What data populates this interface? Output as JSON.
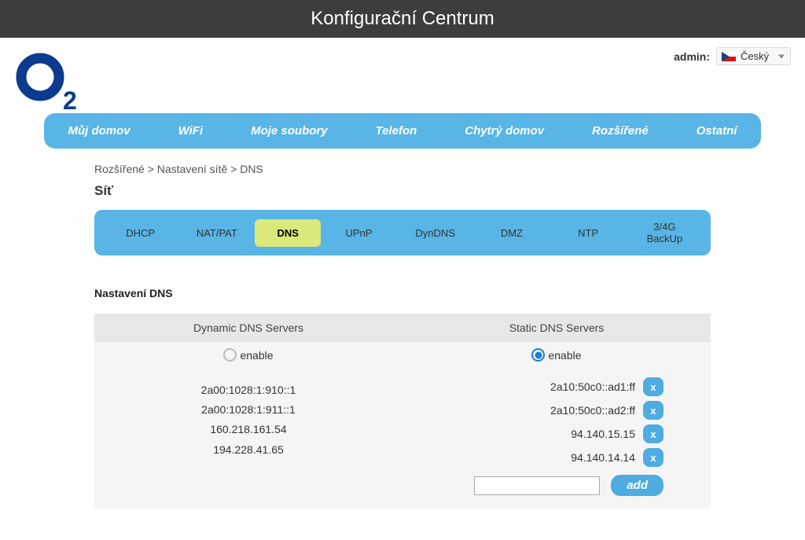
{
  "topbar": {
    "title": "Konfigurační Centrum"
  },
  "header": {
    "admin_label": "admin:",
    "language": "Český"
  },
  "main_nav": [
    "Můj domov",
    "WiFi",
    "Moje soubory",
    "Telefon",
    "Chytrý domov",
    "Rozšířené",
    "Ostatní"
  ],
  "breadcrumb": "Rozšířené > Nastavení sítě > DNS",
  "section_title": "Síť",
  "sub_nav": {
    "tabs": [
      "DHCP",
      "NAT/PAT",
      "DNS",
      "UPnP",
      "DynDNS",
      "DMZ",
      "NTP",
      "3/4G BackUp"
    ],
    "active": "DNS"
  },
  "settings_title": "Nastavení DNS",
  "columns": {
    "dynamic_header": "Dynamic DNS Servers",
    "static_header": "Static DNS Servers",
    "enable_label": "enable"
  },
  "dynamic_servers": [
    "2a00:1028:1:910::1",
    "2a00:1028:1:911::1",
    "160.218.161.54",
    "194.228.41.65"
  ],
  "static_servers": [
    "2a10:50c0::ad1:ff",
    "2a10:50c0::ad2:ff",
    "94.140.15.15",
    "94.140.14.14"
  ],
  "static_selected": true,
  "delete_label": "x",
  "add": {
    "button_label": "add",
    "input_value": ""
  }
}
